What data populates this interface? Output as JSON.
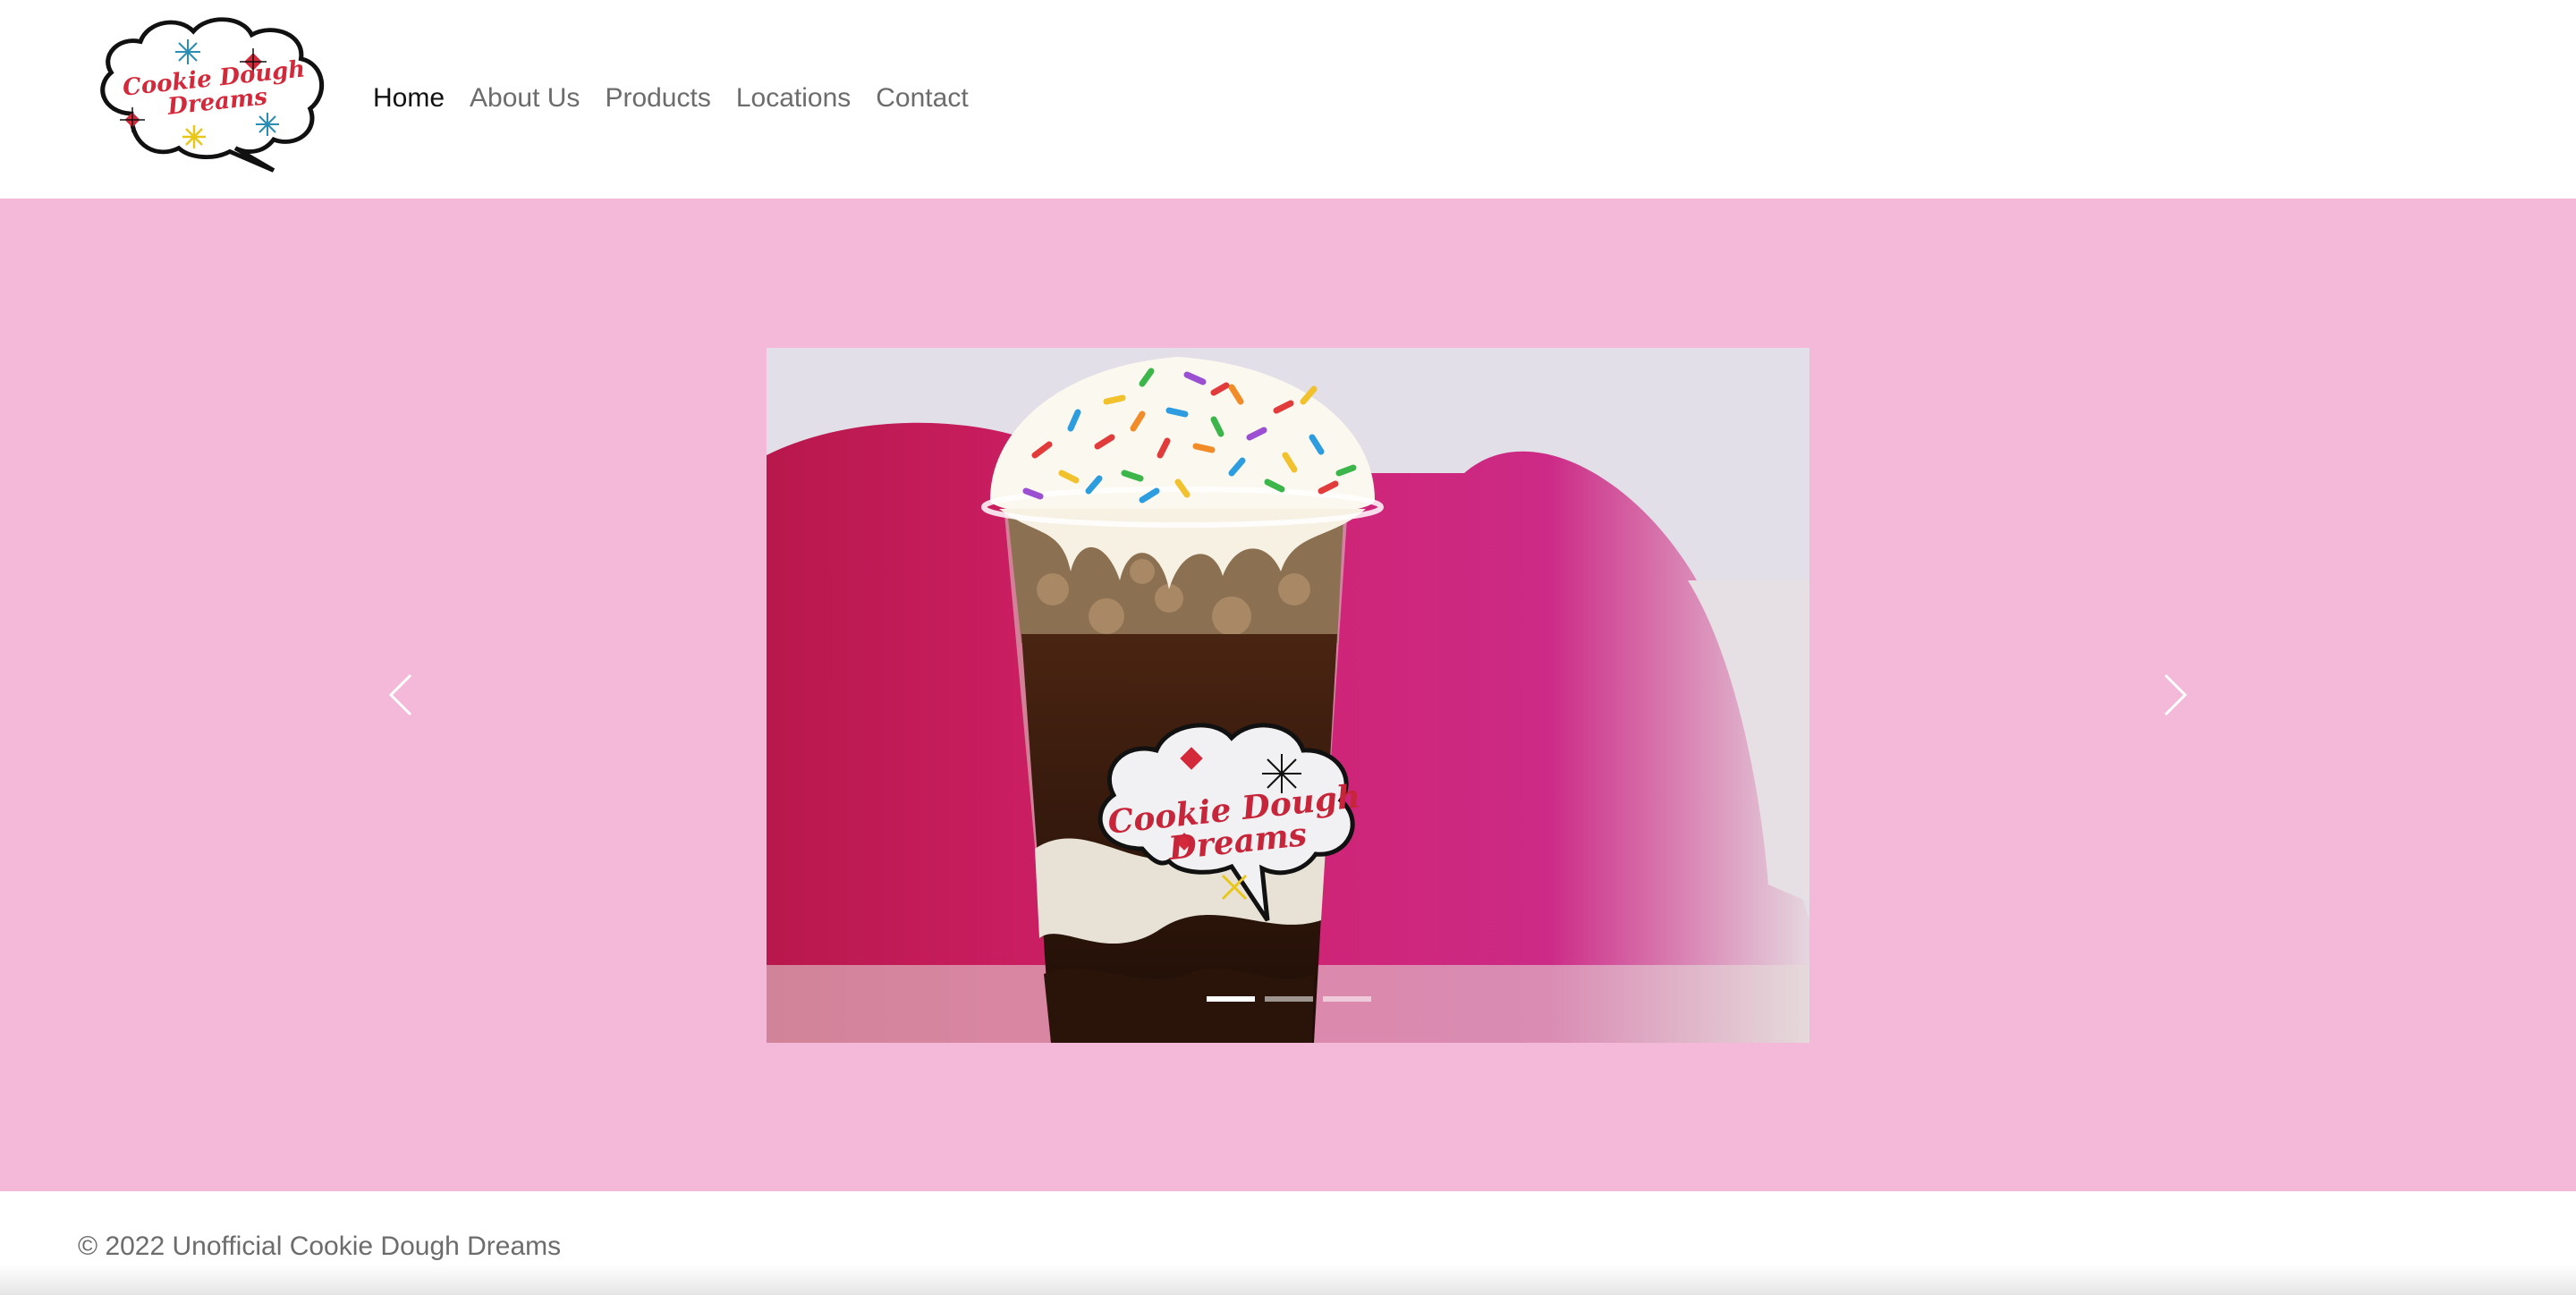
{
  "brand": {
    "logo_line1": "Cookie Dough",
    "logo_line2": "Dreams",
    "logo_text_color": "#d3293a"
  },
  "nav": {
    "items": [
      {
        "label": "Home",
        "active": true
      },
      {
        "label": "About Us",
        "active": false
      },
      {
        "label": "Products",
        "active": false
      },
      {
        "label": "Locations",
        "active": false
      },
      {
        "label": "Contact",
        "active": false
      }
    ]
  },
  "carousel": {
    "background_color": "#f4b9d9",
    "slide_count": 3,
    "active_index": 0,
    "prev_icon": "chevron-left-icon",
    "next_icon": "chevron-right-icon",
    "slide": {
      "cup_label_line1": "Cookie Dough",
      "cup_label_line2": "Dreams"
    }
  },
  "footer": {
    "copyright": "© 2022 Unofficial Cookie Dough Dreams"
  }
}
